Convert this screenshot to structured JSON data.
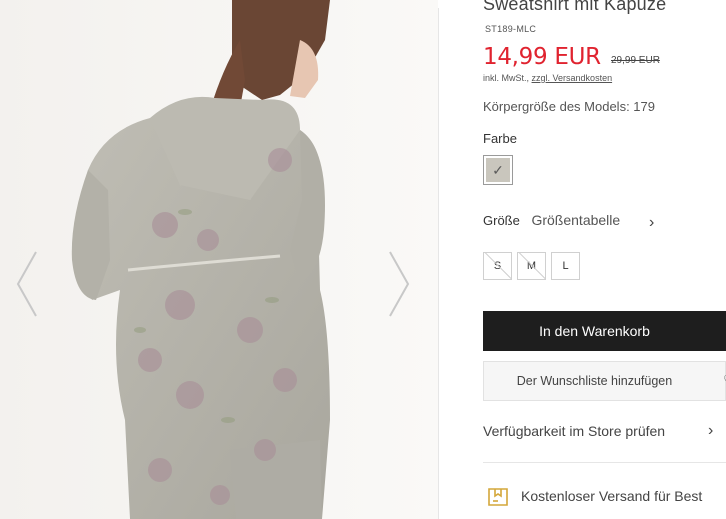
{
  "product": {
    "title": "Sweatshirt mit Kapuze",
    "sku": "ST189-MLC",
    "price": "14,99 EUR",
    "old_price": "29,99 EUR",
    "tax_note": "inkl. MwSt.,",
    "shipping_link": "zzgl. Versandkosten",
    "model_height": "Körpergröße des Models: 179"
  },
  "color": {
    "label": "Farbe",
    "selected_mark": "✓",
    "swatch_color": "#c9c6bd"
  },
  "size": {
    "label": "Größe",
    "table_link": "Größentabelle",
    "chevron": "›",
    "options": [
      {
        "label": "S",
        "available": false
      },
      {
        "label": "M",
        "available": false
      },
      {
        "label": "L",
        "available": true
      }
    ]
  },
  "actions": {
    "add_to_cart": "In den Warenkorb",
    "wishlist": "Der Wunschliste hinzufügen",
    "wishlist_icon": "♡"
  },
  "store": {
    "check_availability": "Verfügbarkeit im Store prüfen",
    "chevron": "›"
  },
  "shipping": {
    "free_shipping": "Kostenloser Versand für Best"
  },
  "colors": {
    "price_red": "#e0232f",
    "cart_button_bg": "#1e1e1e"
  }
}
